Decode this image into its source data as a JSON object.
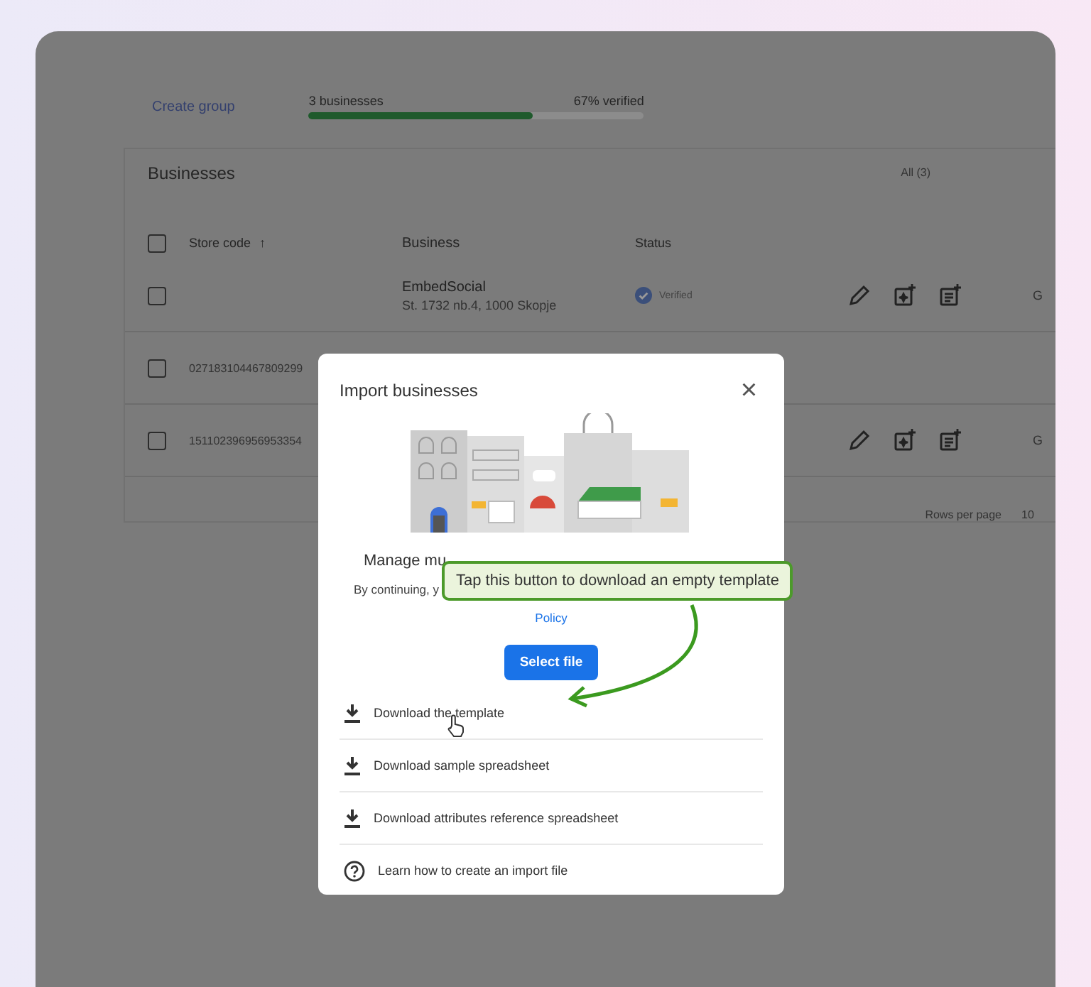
{
  "top_bar": {
    "create_group": "Create group",
    "progress": {
      "label": "3 businesses",
      "reading": "67% verified",
      "level": 0.67
    }
  },
  "businesses": {
    "title": "Businesses",
    "filter": "All (3)",
    "select_all": {
      "checked": false
    },
    "columns": [
      {
        "label": "Store code",
        "sort_arrow": "↑"
      },
      {
        "label": "Business"
      },
      {
        "label": "Status"
      }
    ],
    "rows": [
      {
        "store_code": "",
        "name": "EmbedSocial",
        "address": "St. 1732 nb.4, 1000 Skopje",
        "status": "Verified",
        "checked": false,
        "actions": true,
        "column_extra": "G"
      },
      {
        "store_code": "027183104467809299",
        "name": "",
        "address": "",
        "status": "",
        "checked": false,
        "actions": false,
        "column_extra": ""
      },
      {
        "store_code": "151102396956953354",
        "name": "",
        "address": "",
        "status": "",
        "checked": false,
        "actions": true,
        "column_extra": "G"
      }
    ],
    "rows_per_page": {
      "label": "Rows per page",
      "value": "10"
    }
  },
  "dialog": {
    "title": "Import businesses",
    "close": "×",
    "intro": "Manage mu",
    "terms": "By continuing, y",
    "policy_link": "Policy",
    "select_button": "Select file",
    "items": [
      {
        "kind": "download",
        "label": "Download the template"
      },
      {
        "kind": "download",
        "label": "Download sample spreadsheet"
      },
      {
        "kind": "download",
        "label": "Download attributes reference spreadsheet"
      },
      {
        "kind": "help",
        "label": "Learn how to create an import file"
      }
    ]
  },
  "tooltip": "Tap this button to download an empty template"
}
